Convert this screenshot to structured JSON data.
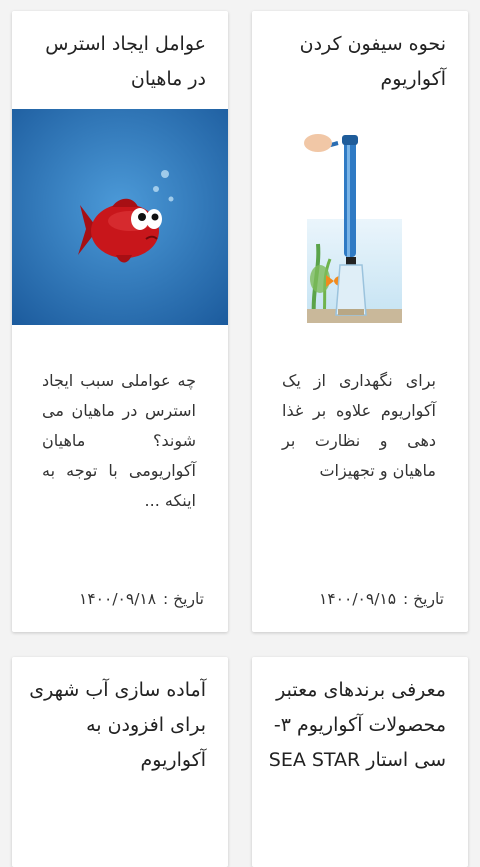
{
  "posts": [
    {
      "title": "نحوه سیفون کردن آکواریوم",
      "excerpt": "برای نگهداری از یک آکواریوم علاوه بر غذا دهی و نظارت بر ماهیان و تجهیزات",
      "date_label": "تاریخ :",
      "date_value": "۱۴۰۰/۰۹/۱۵",
      "image_icon": "aquarium-siphon-illustration"
    },
    {
      "title": "عوامل ایجاد استرس در ماهیان",
      "excerpt": "چه عواملی سبب ایجاد استرس در ماهیان می شوند؟ ماهیان آکواریومی با توجه به اینکه ...",
      "date_label": "تاریخ :",
      "date_value": "۱۴۰۰/۰۹/۱۸",
      "image_icon": "stressed-red-fish-illustration"
    },
    {
      "title": "معرفی برندهای معتبر محصولات آکواریوم ۳- سی استار SEA STAR"
    },
    {
      "title": "آماده سازی آب شهری برای افزودن به آکواریوم"
    }
  ],
  "colors": {
    "card_bg": "#ffffff",
    "page_bg": "#f3f3f3",
    "fish_bg_top": "#3f8fd0",
    "fish_bg_bottom": "#1d5fa3",
    "fish_red": "#c8161b"
  }
}
